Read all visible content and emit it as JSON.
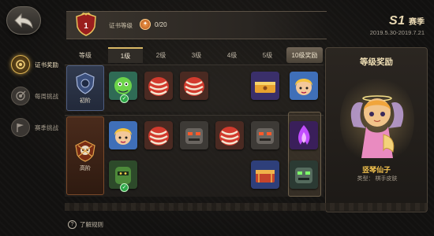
{
  "header": {
    "level_badge": "1",
    "level_label": "证书等级",
    "points_value": "0/20",
    "season_code": "S1",
    "season_word": "赛季",
    "season_dates": "2019.5.30-2019.7.21"
  },
  "sidebar": {
    "items": [
      {
        "label": "证书奖励",
        "icon": "certificate-icon",
        "active": true
      },
      {
        "label": "每周挑战",
        "icon": "target-icon",
        "active": false
      },
      {
        "label": "赛季挑战",
        "icon": "flag-icon",
        "active": false
      }
    ]
  },
  "grid": {
    "columns": [
      "等级",
      "1级",
      "2级",
      "3级",
      "4级",
      "5级",
      "10级奖励"
    ],
    "tiers": [
      {
        "name": "初阶",
        "color": "#4f5e80"
      },
      {
        "name": "高阶",
        "color": "#7a4a2a"
      }
    ],
    "rows": [
      [
        "green-hero",
        "red-chest",
        "red-chest",
        "",
        "gold-chest",
        "blonde-hero"
      ],
      [
        "blonde-hero",
        "red-chest",
        "stone-golem",
        "red-chest",
        "stone-golem",
        "purple-flame"
      ],
      [
        "green-armor-hero",
        "",
        "",
        "",
        "red-chest-open",
        "green-golem"
      ]
    ],
    "checks": [
      [
        true,
        false,
        false,
        false,
        false,
        false
      ],
      [
        false,
        false,
        false,
        false,
        false,
        false
      ],
      [
        true,
        false,
        false,
        false,
        false,
        false
      ]
    ]
  },
  "reward_panel": {
    "title": "等级奖励",
    "item_name": "竖琴仙子",
    "type_label": "类型：",
    "type_value": "棋手皮肤"
  },
  "footer": {
    "rules_label": "了解规则"
  },
  "colors": {
    "accent_gold": "#e0b553",
    "reward_name": "#f3c24e",
    "background": "#141312"
  }
}
